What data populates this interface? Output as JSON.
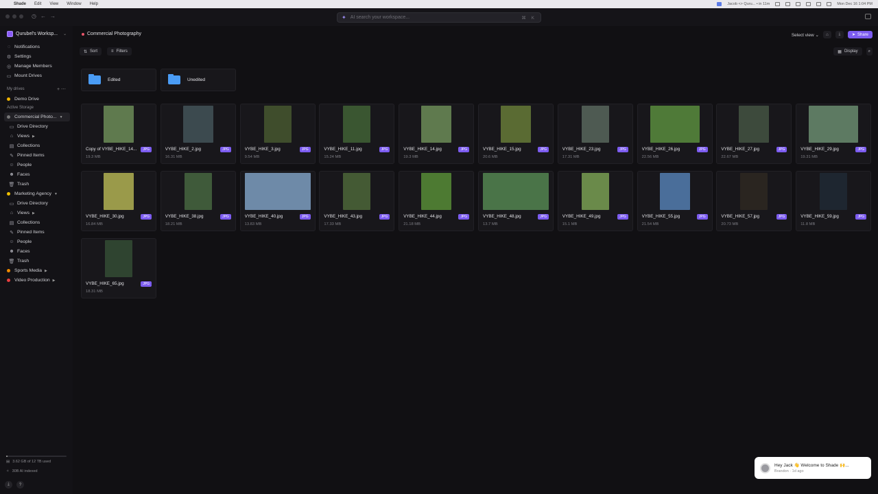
{
  "menubar": {
    "app": "Shade",
    "items": [
      "Edit",
      "View",
      "Window",
      "Help"
    ],
    "meeting": "Jacob <> Quru... • in 11m",
    "clock": "Mon Dec 16  1:04 PM"
  },
  "search": {
    "placeholder": "AI search your workspace...",
    "shortcut": "⌘ K"
  },
  "sidebar": {
    "workspace": "Qurubel's Worksp...",
    "top": [
      {
        "label": "Notifications",
        "icon": "bell-icon"
      },
      {
        "label": "Settings",
        "icon": "gear-icon"
      },
      {
        "label": "Manage Members",
        "icon": "users-icon"
      },
      {
        "label": "Mount Drives",
        "icon": "drive-icon"
      }
    ],
    "my_drives_label": "My drives",
    "demo_drive": "Demo Drive",
    "active_storage_label": "Active Storage",
    "commercial": "Commercial Photo...",
    "commercial_items": [
      "Drive Directory",
      "Views",
      "Collections",
      "Pinned Items",
      "People",
      "Faces",
      "Trash"
    ],
    "marketing": "Marketing Agency",
    "marketing_items": [
      "Drive Directory",
      "Views",
      "Collections",
      "Pinned Items",
      "People",
      "Faces",
      "Trash"
    ],
    "sports": "Sports Media",
    "video": "Video Production",
    "storage_text": "3.62 GB of 12 TB used",
    "storage_fraction": 0.0003,
    "indexed_text": "30B AI indexed"
  },
  "main": {
    "breadcrumb": "Commercial Photography",
    "select_view": "Select view",
    "share": "Share",
    "sort": "Sort",
    "filters": "Filters",
    "display": "Display",
    "folders": [
      "Edited",
      "Unedited"
    ],
    "files": [
      {
        "name": "Copy of VYBE_HIKE_14...",
        "size": "19.3 MB",
        "type": "JPG",
        "bg": "#5f7a4e"
      },
      {
        "name": "VYBE_HIKE_2.jpg",
        "size": "16.31 MB",
        "type": "JPG",
        "bg": "#3c4a4f"
      },
      {
        "name": "VYBE_HIKE_3.jpg",
        "size": "9.54 MB",
        "type": "JPG",
        "bg": "#3f4d2c"
      },
      {
        "name": "VYBE_HIKE_11.jpg",
        "size": "15.24 MB",
        "type": "JPG",
        "bg": "#3a5631"
      },
      {
        "name": "VYBE_HIKE_14.jpg",
        "size": "19.3 MB",
        "type": "JPG",
        "bg": "#5f7a4e"
      },
      {
        "name": "VYBE_HIKE_15.jpg",
        "size": "20.6 MB",
        "type": "JPG",
        "bg": "#5a6b33"
      },
      {
        "name": "VYBE_HIKE_23.jpg",
        "size": "17.31 MB",
        "type": "JPG",
        "bg": "#4e5a52"
      },
      {
        "name": "VYBE_HIKE_26.jpg",
        "size": "22.56 MB",
        "type": "JPG",
        "bg": "#4f7a38"
      },
      {
        "name": "VYBE_HIKE_27.jpg",
        "size": "22.67 MB",
        "type": "JPG",
        "bg": "#3d4a3c"
      },
      {
        "name": "VYBE_HIKE_29.jpg",
        "size": "19.31 MB",
        "type": "JPG",
        "bg": "#5d7a62"
      },
      {
        "name": "VYBE_HIKE_30.jpg",
        "size": "16.84 MB",
        "type": "JPG",
        "bg": "#9a9a4a"
      },
      {
        "name": "VYBE_HIKE_38.jpg",
        "size": "18.21 MB",
        "type": "JPG",
        "bg": "#3f5a3a"
      },
      {
        "name": "VYBE_HIKE_40.jpg",
        "size": "13.83 MB",
        "type": "JPG",
        "bg": "#6e8aa8"
      },
      {
        "name": "VYBE_HIKE_43.jpg",
        "size": "17.33 MB",
        "type": "JPG",
        "bg": "#445a34"
      },
      {
        "name": "VYBE_HIKE_44.jpg",
        "size": "21.18 MB",
        "type": "JPG",
        "bg": "#4d7a32"
      },
      {
        "name": "VYBE_HIKE_48.jpg",
        "size": "13.7 MB",
        "type": "JPG",
        "bg": "#4a7448"
      },
      {
        "name": "VYBE_HIKE_49.jpg",
        "size": "15.1 MB",
        "type": "JPG",
        "bg": "#6a8a4a"
      },
      {
        "name": "VYBE_HIKE_55.jpg",
        "size": "21.54 MB",
        "type": "JPG",
        "bg": "#4a6e9a"
      },
      {
        "name": "VYBE_HIKE_57.jpg",
        "size": "20.73 MB",
        "type": "JPG",
        "bg": "#2a2520"
      },
      {
        "name": "VYBE_HIKE_59.jpg",
        "size": "11.8 MB",
        "type": "JPG",
        "bg": "#1e2630"
      },
      {
        "name": "VYBE_HIKE_65.jpg",
        "size": "18.31 MB",
        "type": "JPG",
        "bg": "#2f4430"
      }
    ]
  },
  "toast": {
    "message": "Hey Jack 👋 Welcome to Shade 🙌...",
    "meta": "Brandon · 1d ago"
  }
}
